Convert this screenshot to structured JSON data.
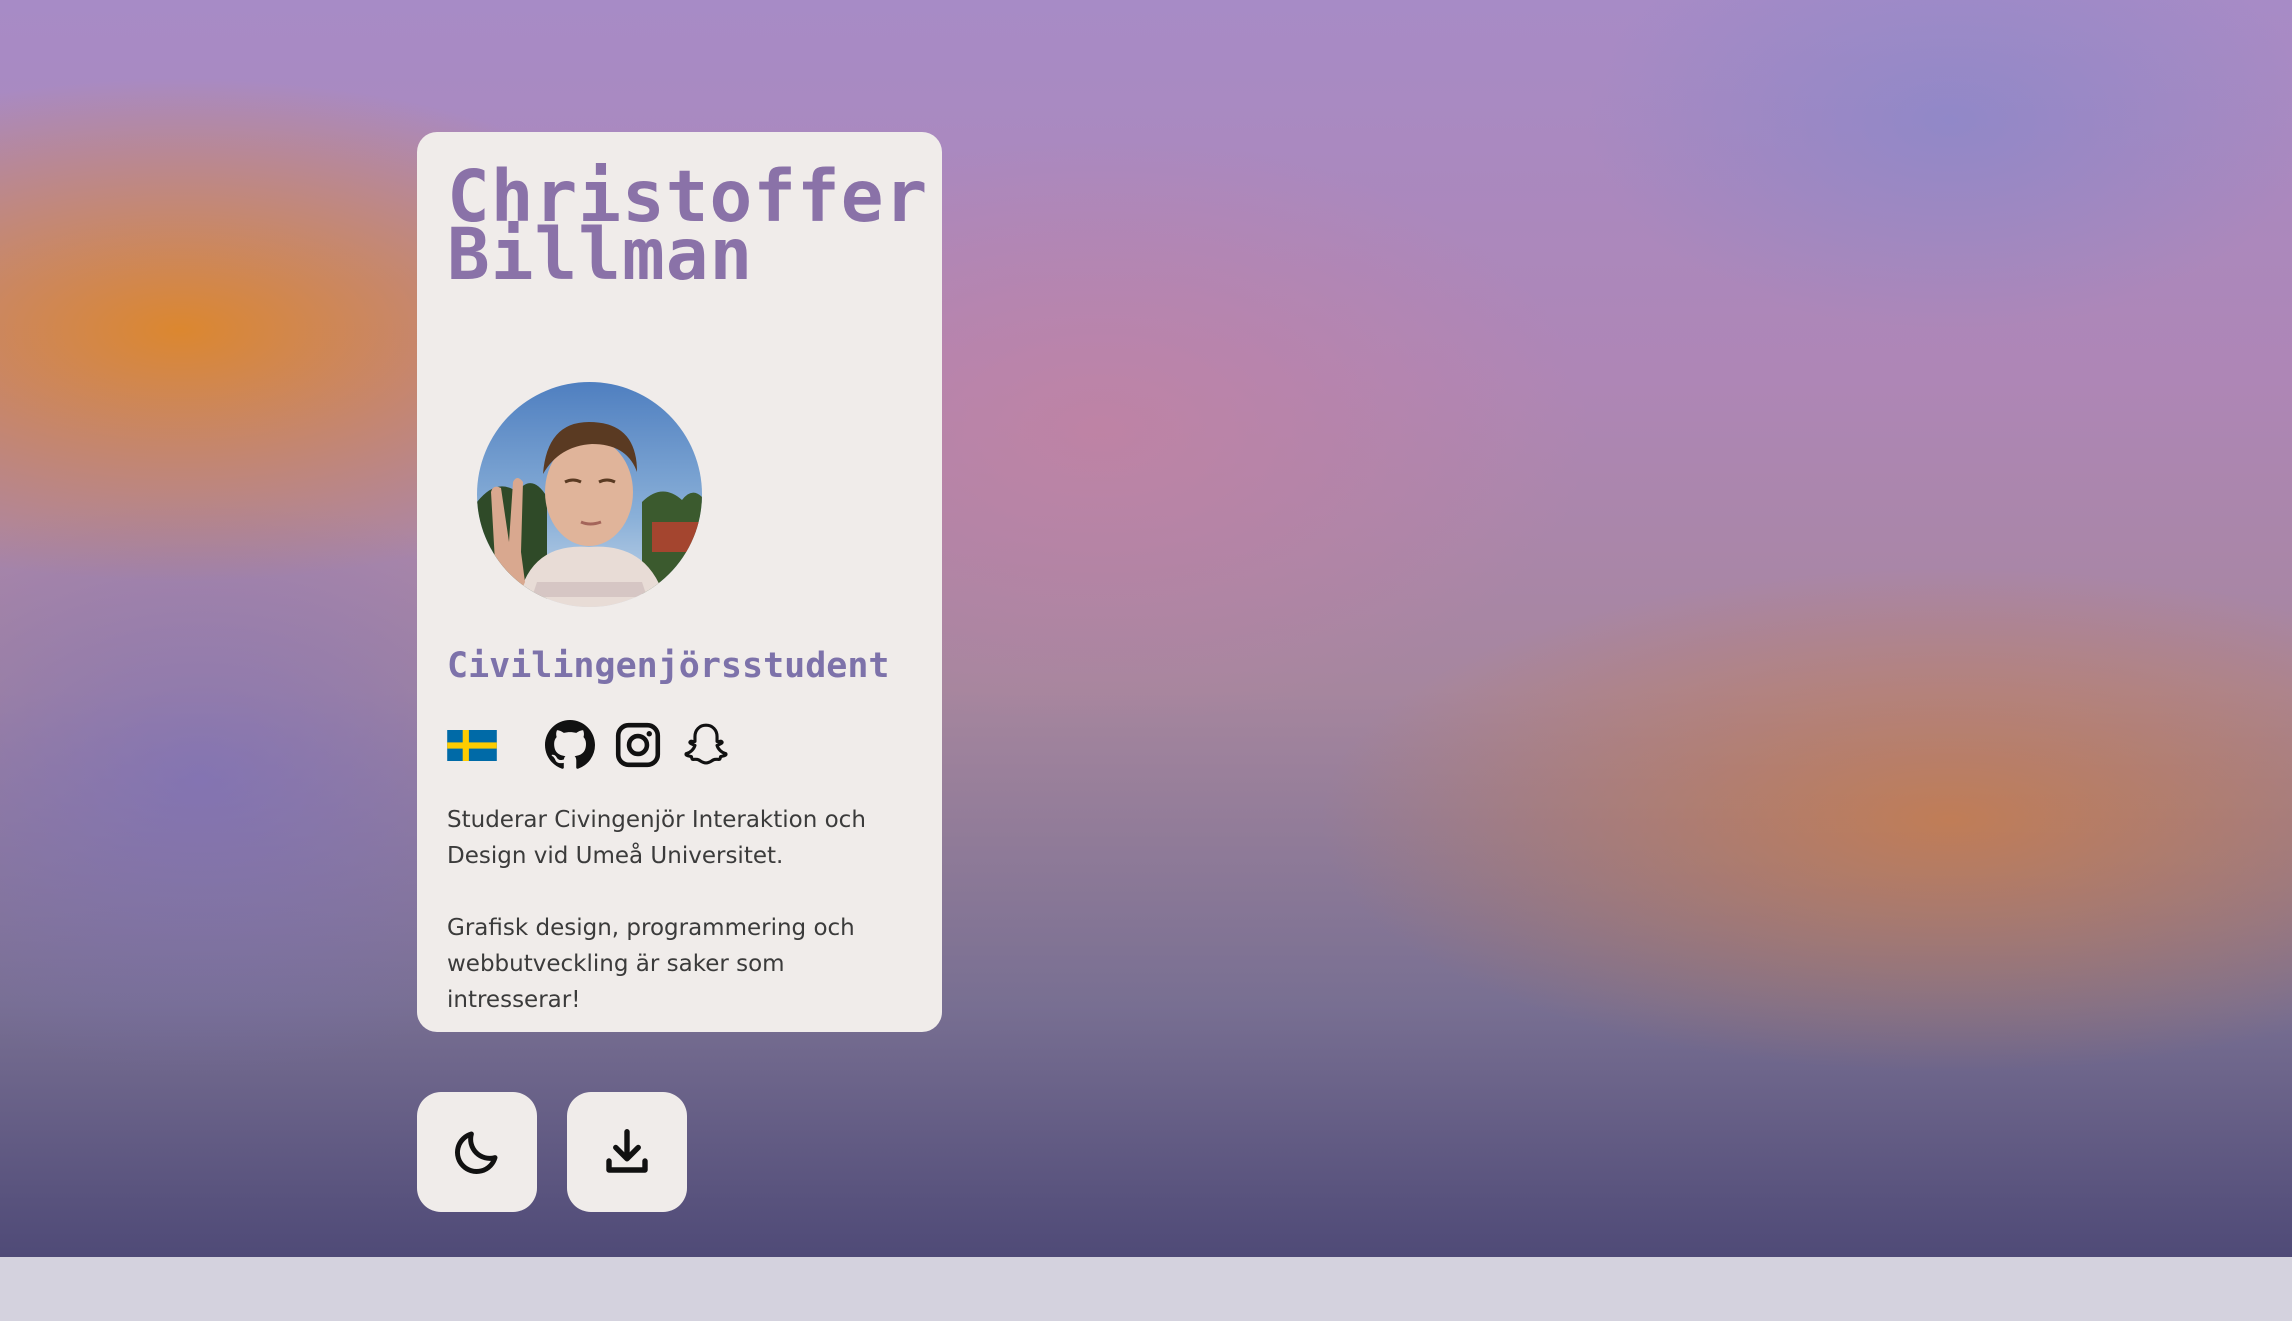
{
  "profile": {
    "name_line1": "Christoffer",
    "name_line2": "Billman",
    "role": "Civilingenjörsstudent",
    "bio_paragraph1": "Studerar Civingenjör Interaktion och Design vid Umeå Universitet.",
    "bio_paragraph2": "Grafisk design, programmering och webbutveckling är saker som intresserar!"
  },
  "icons": {
    "flag": "sweden-flag-icon",
    "social": [
      "github-icon",
      "instagram-icon",
      "snapchat-icon"
    ],
    "buttons": [
      "moon-icon",
      "download-icon"
    ]
  },
  "colors": {
    "name": "#8a72a8",
    "role": "#7d72aa",
    "card": "#f0ecea",
    "flag_blue": "#006aa7",
    "flag_yellow": "#fecc00"
  }
}
